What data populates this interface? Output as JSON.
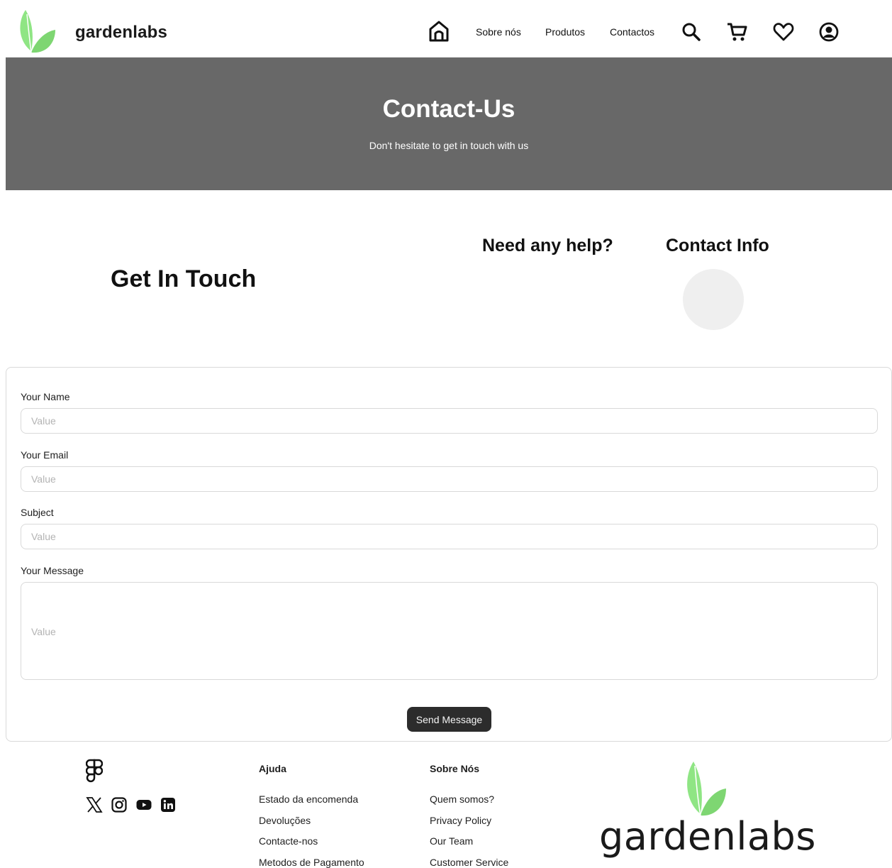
{
  "header": {
    "brand": "gardenlabs",
    "nav": [
      "Sobre nós",
      "Produtos",
      "Contactos"
    ],
    "icons": [
      "home-icon",
      "search-icon",
      "cart-icon",
      "heart-icon",
      "user-circle-icon"
    ]
  },
  "hero": {
    "title": "Contact-Us",
    "subtitle": "Don't hesitate to get in touch with us"
  },
  "help": {
    "get_in_touch": "Get In Touch",
    "need_help": "Need any help?",
    "contact_info": "Contact Info"
  },
  "form": {
    "name_label": "Your Name",
    "name_placeholder": "Value",
    "email_label": "Your Email",
    "email_placeholder": "Value",
    "subject_label": "Subject",
    "subject_placeholder": "Value",
    "message_label": "Your Message",
    "message_placeholder": "Value",
    "send_label": "Send Message"
  },
  "footer": {
    "icons": [
      "figma-icon",
      "x-icon",
      "instagram-icon",
      "youtube-icon",
      "linkedin-icon"
    ],
    "col1": {
      "heading": "Ajuda",
      "links": [
        "Estado da encomenda",
        "Devoluções",
        "Contacte-nos",
        "Metodos de Pagamento"
      ]
    },
    "col2": {
      "heading": "Sobre Nós",
      "links": [
        "Quem somos?",
        "Privacy Policy",
        "Our Team",
        "Customer Service"
      ]
    },
    "brand": "gardenlabs"
  },
  "colors": {
    "leaf_green": "#86e07a",
    "hero_bg": "#686868",
    "button_bg": "#2c2c2c"
  }
}
